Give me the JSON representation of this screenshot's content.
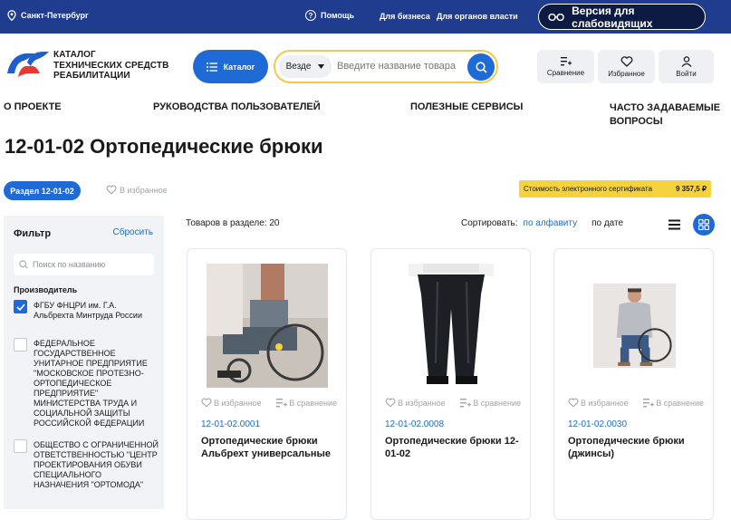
{
  "topbar": {
    "city": "Санкт-Петербург",
    "help": "Помощь",
    "business": "Для бизнеса",
    "authorities": "Для органов власти",
    "vision": "Версия для слабовидящих"
  },
  "header": {
    "logo_lines": [
      "КАТАЛОГ",
      "ТЕХНИЧЕСКИХ СРЕДСТВ",
      "РЕАБИЛИТАЦИИ"
    ],
    "catalog_button": "Каталог",
    "search_scope": "Везде",
    "search_placeholder": "Введите название товара",
    "compare": "Сравнение",
    "favorites": "Избранное",
    "login": "Войти"
  },
  "nav": {
    "about": "О ПРОЕКТЕ",
    "guides": "РУКОВОДСТВА ПОЛЬЗОВАТЕЛЕЙ",
    "services": "ПОЛЕЗНЫЕ СЕРВИСЫ",
    "faq_1": "ЧАСТО ЗАДАВАЕМЫЕ",
    "faq_2": "ВОПРОСЫ"
  },
  "page": {
    "title": "12-01-02 Ортопедические брюки",
    "section_chip": "Раздел 12-01-02",
    "add_favorite": "В избранное",
    "certificate_label": "Стоимость электронного сертификата",
    "certificate_value": "9 357,5 ₽"
  },
  "filter": {
    "title": "Фильтр",
    "reset": "Сбросить",
    "search_placeholder": "Поиск по названию",
    "manufacturer_label": "Производитель",
    "options": [
      {
        "label": "ФГБУ ФНЦРИ им. Г.А. Альбрехта Минтруда России",
        "checked": true
      },
      {
        "label": "ФЕДЕРАЛЬНОЕ ГОСУДАРСТВЕННОЕ УНИТАРНОЕ ПРЕДПРИЯТИЕ \"МОСКОВСКОЕ ПРОТЕЗНО-ОРТОПЕДИЧЕСКОЕ ПРЕДПРИЯТИЕ\" МИНИСТЕРСТВА ТРУДА И СОЦИАЛЬНОЙ ЗАЩИТЫ РОССИЙСКОЙ ФЕДЕРАЦИИ",
        "checked": false
      },
      {
        "label": "ОБЩЕСТВО С ОГРАНИЧЕННОЙ ОТВЕТСТВЕННОСТЬЮ \"ЦЕНТР ПРОЕКТИРОВАНИЯ ОБУВИ СПЕЦИАЛЬНОГО НАЗНАЧЕНИЯ \"ОРТОМОДА\"",
        "checked": false
      }
    ]
  },
  "listing": {
    "count": "Товаров в разделе: 20",
    "sort_label": "Сортировать:",
    "sort_alpha": "по алфавиту",
    "sort_date": "по дате"
  },
  "products": [
    {
      "code": "12-01-02.0001",
      "name": "Ортопедические брюки Альбрехт универсальные",
      "fav": "В избранное",
      "compare": "В сравнение"
    },
    {
      "code": "12-01-02.0008",
      "name": "Ортопедические брюки 12-01-02",
      "fav": "В избранное",
      "compare": "В сравнение"
    },
    {
      "code": "12-01-02.0030",
      "name": "Ортопедические брюки (джинсы)",
      "fav": "В избранное",
      "compare": "В сравнение"
    }
  ],
  "colors": {
    "brand": "#1f3c8f",
    "accent": "#1e6ad6",
    "highlight": "#f6d33c"
  }
}
